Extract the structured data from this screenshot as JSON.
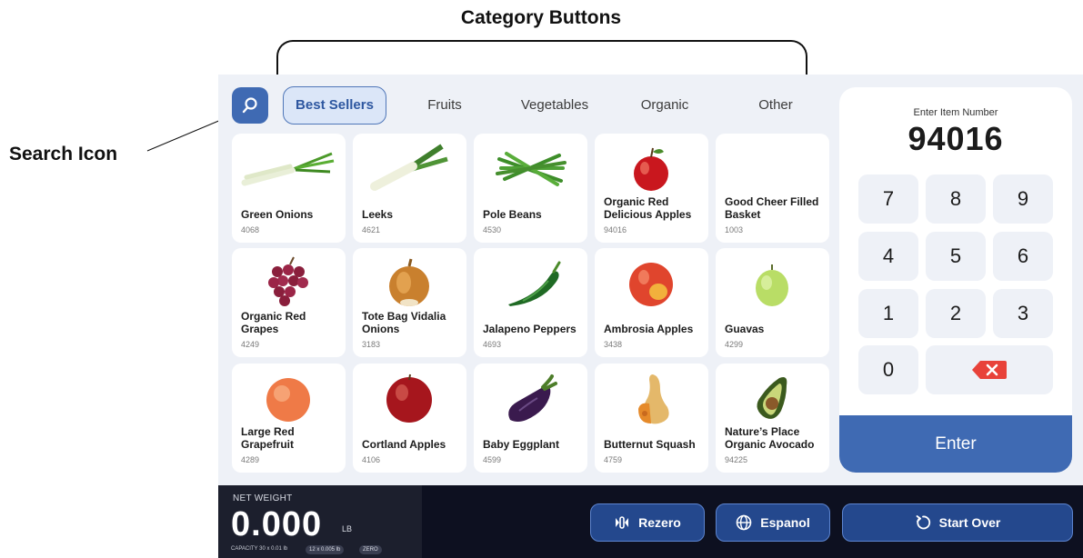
{
  "annotations": {
    "category_buttons": "Category Buttons",
    "search_icon": "Search Icon"
  },
  "categories": [
    {
      "label": "Best Sellers",
      "active": true
    },
    {
      "label": "Fruits",
      "active": false
    },
    {
      "label": "Vegetables",
      "active": false
    },
    {
      "label": "Organic",
      "active": false
    },
    {
      "label": "Other",
      "active": false
    }
  ],
  "products": [
    {
      "name": "Green Onions",
      "code": "4068",
      "icon": "green-onion-icon"
    },
    {
      "name": "Leeks",
      "code": "4621",
      "icon": "leek-icon"
    },
    {
      "name": "Pole Beans",
      "code": "4530",
      "icon": "pole-beans-icon"
    },
    {
      "name": "Organic Red Delicious Apples",
      "code": "94016",
      "icon": "red-apple-icon"
    },
    {
      "name": "Good Cheer Filled Basket",
      "code": "1003",
      "icon": ""
    },
    {
      "name": "Organic Red Grapes",
      "code": "4249",
      "icon": "grapes-icon"
    },
    {
      "name": "Tote Bag Vidalia Onions",
      "code": "3183",
      "icon": "onion-icon"
    },
    {
      "name": "Jalapeno Peppers",
      "code": "4693",
      "icon": "jalapeno-icon"
    },
    {
      "name": "Ambrosia Apples",
      "code": "3438",
      "icon": "ambrosia-apple-icon"
    },
    {
      "name": "Guavas",
      "code": "4299",
      "icon": "guava-icon"
    },
    {
      "name": "Large Red Grapefruit",
      "code": "4289",
      "icon": "grapefruit-icon"
    },
    {
      "name": "Cortland Apples",
      "code": "4106",
      "icon": "cortland-apple-icon"
    },
    {
      "name": "Baby Eggplant",
      "code": "4599",
      "icon": "eggplant-icon"
    },
    {
      "name": "Butternut Squash",
      "code": "4759",
      "icon": "butternut-squash-icon"
    },
    {
      "name": "Nature’s Place Organic Avocado",
      "code": "94225",
      "icon": "avocado-icon"
    }
  ],
  "keypad": {
    "label": "Enter Item Number",
    "value": "94016",
    "keys": [
      "7",
      "8",
      "9",
      "4",
      "5",
      "6",
      "1",
      "2",
      "3",
      "0"
    ],
    "enter_label": "Enter"
  },
  "scale": {
    "label": "NET WEIGHT",
    "value": "0.000",
    "unit": "LB",
    "capacity": "CAPACITY 30 x 0.01 lb",
    "division": "12 x 0.005 lb",
    "zero": "ZERO"
  },
  "actions": {
    "rezero": "Rezero",
    "espanol": "Espanol",
    "start_over": "Start Over"
  },
  "colors": {
    "accent": "#3f6ab3",
    "background": "#eef1f7",
    "bottom_bar": "#0d1020",
    "delete": "#e8423a"
  }
}
